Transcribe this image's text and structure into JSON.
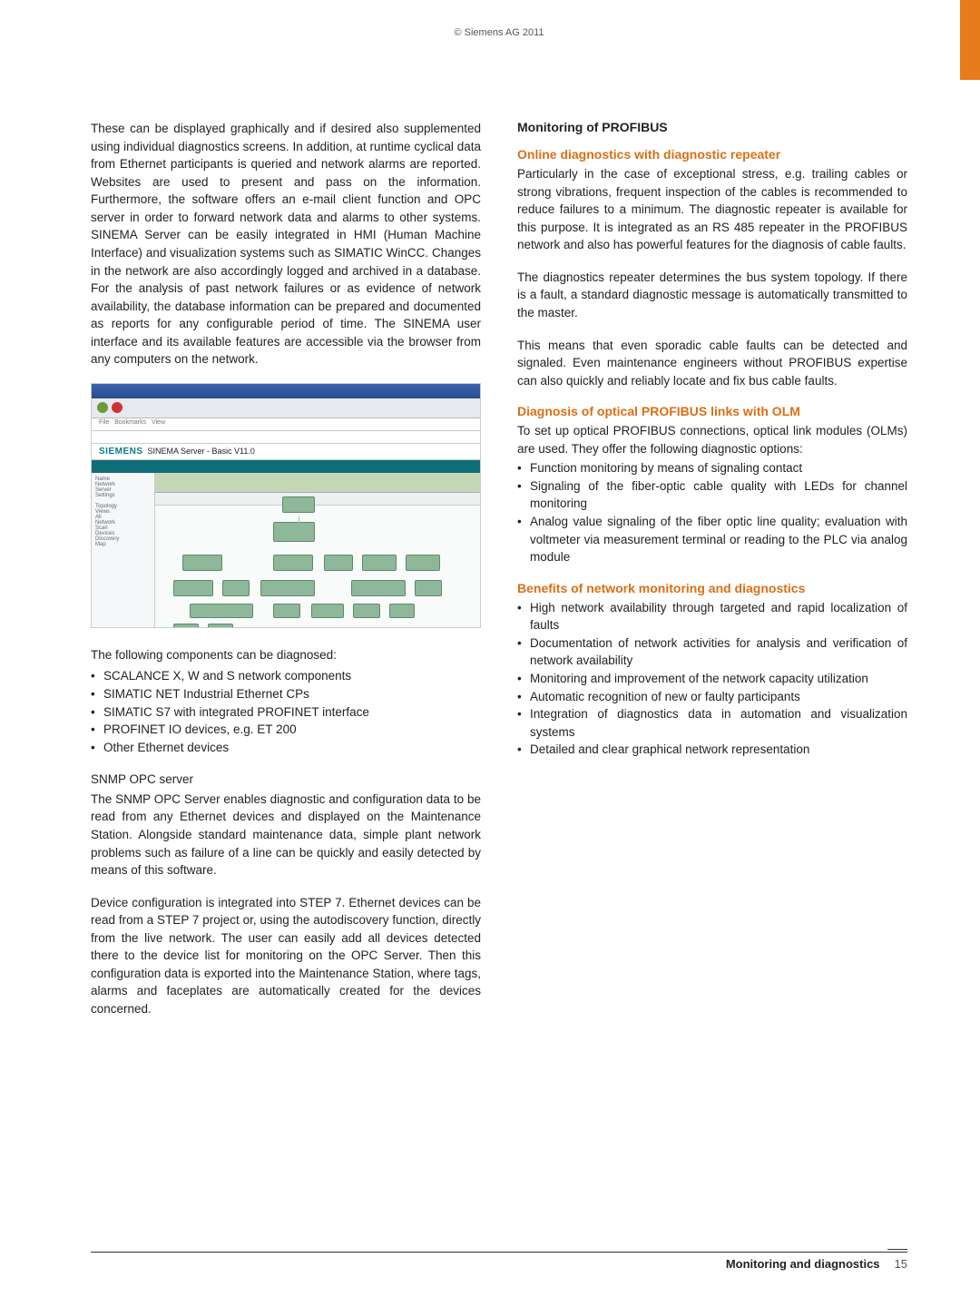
{
  "copyright": "© Siemens AG 2011",
  "left": {
    "p1": "These can be displayed graphically and if desired also supplemented using individual diagnostics screens. In addition, at runtime cyclical data from Ethernet participants is queried and network alarms are reported. Websites are used to present and pass on the information. Furthermore, the software offers an e-mail client function and OPC server in order to forward network data and alarms to other systems. SINEMA Server can be easily integrated in HMI (Human Machine Interface) and visualization systems such as SIMATIC WinCC. Changes in the network are also accordingly logged and archived in a database. For the analysis of past network failures or as evidence of network availability, the database information can be prepared and documented as reports for any configurable period of time. The SINEMA user interface and its available features are accessible via the browser from any computers on the network.",
    "screenshot_brand": "SIEMENS",
    "screenshot_sub": "SINEMA Server - Basic V11.0",
    "diag_intro": "The following components can be diagnosed:",
    "diag_list": [
      "SCALANCE X, W and S network components",
      "SIMATIC NET Industrial Ethernet CPs",
      "SIMATIC S7 with integrated PROFINET interface",
      "PROFINET IO devices, e.g. ET 200",
      "Other Ethernet devices"
    ],
    "snmp_title": "SNMP OPC server",
    "snmp_p1": "The SNMP OPC Server enables diagnostic and configuration data to be read from any Ethernet devices and displayed on the Maintenance Station.  Alongside standard maintenance data, simple plant network problems such as failure of a line can be quickly and easily detected by means of this software.",
    "snmp_p2": "Device configuration is integrated into STEP 7. Ethernet devices can be read from a STEP 7 project or, using the autodiscovery function, directly from the live network. The user can easily add all devices detected there to the device list for monitoring on the OPC Server. Then this configuration data is exported into the Maintenance Station, where tags, alarms and faceplates are automatically created for the devices concerned."
  },
  "right": {
    "h1": "Monitoring of PROFIBUS",
    "sub1": "Online diagnostics with diagnostic repeater",
    "p1": "Particularly in the case of exceptional stress, e.g. trailing cables or strong vibrations, frequent inspection of the cables is recommended to reduce failures to a minimum. The diagnostic repeater is available for this purpose. It is integrated as an RS 485 repeater in the PROFIBUS network and also has powerful features for the diagnosis of cable faults.",
    "p2": "The diagnostics repeater determines the bus system topology. If there is a fault, a standard diagnostic message is automatically transmitted to the master.",
    "p3": "This means that even sporadic cable faults can be detected and signaled. Even maintenance engineers without PROFIBUS expertise can also quickly and reliably locate and fix bus cable faults.",
    "sub2": "Diagnosis of optical PROFIBUS links with OLM",
    "p4": "To set up optical PROFIBUS connections, optical link modules (OLMs) are used. They offer the following diagnostic options:",
    "olm_list": [
      "Function monitoring by means of signaling contact",
      "Signaling of the fiber-optic cable quality with LEDs for channel monitoring",
      "Analog value signaling of the fiber optic line quality; evaluation with voltmeter via measurement terminal or reading to the PLC via analog module"
    ],
    "sub3": "Benefits of network monitoring and diagnostics",
    "ben_list": [
      "High network availability through targeted and rapid localization of faults",
      "Documentation of network activities for analysis and verification of network availability",
      "Monitoring and improvement of the network capacity utilization",
      "Automatic recognition of new or faulty participants",
      "Integration of diagnostics data in automation and visualization systems",
      "Detailed and clear graphical network representation"
    ]
  },
  "footer": {
    "section": "Monitoring and diagnostics",
    "page": "15"
  }
}
